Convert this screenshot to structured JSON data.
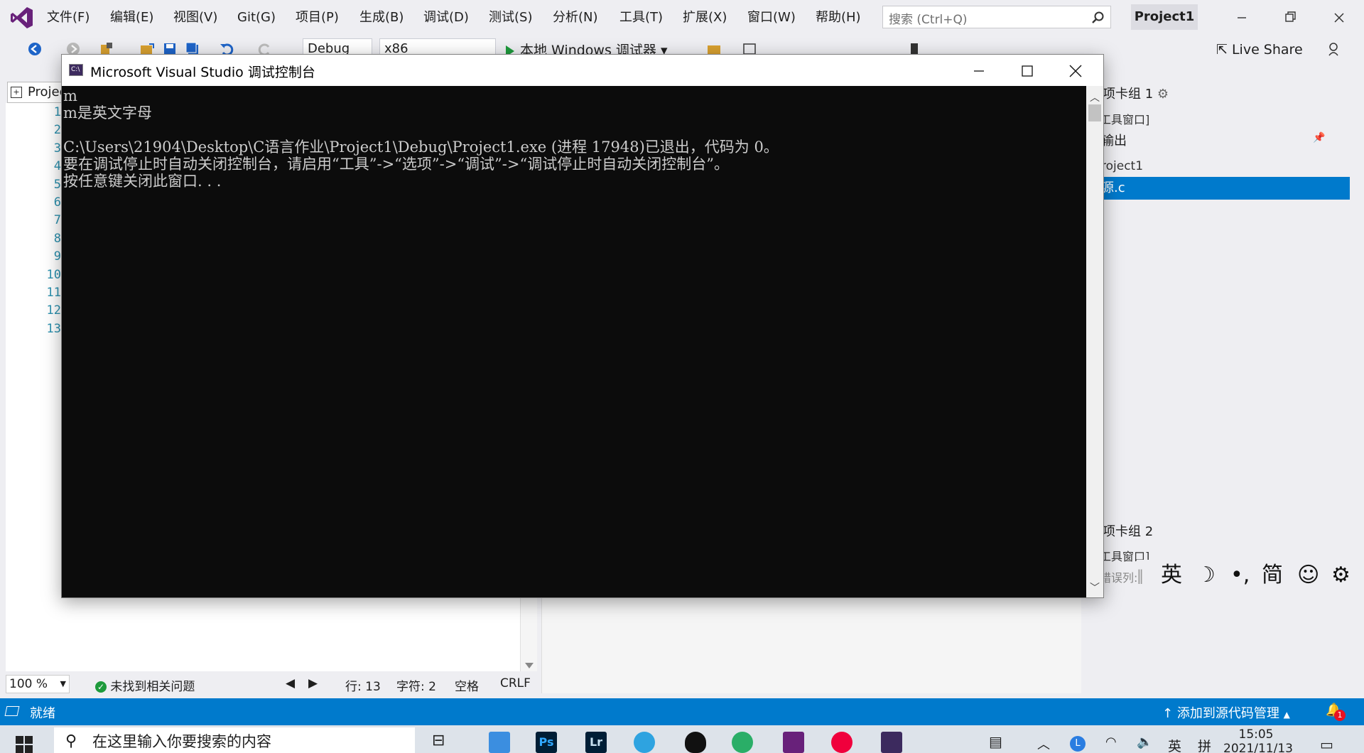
{
  "menubar": {
    "items": [
      "文件(F)",
      "编辑(E)",
      "视图(V)",
      "Git(G)",
      "项目(P)",
      "生成(B)",
      "调试(D)",
      "测试(S)",
      "分析(N)",
      "工具(T)",
      "扩展(X)",
      "窗口(W)",
      "帮助(H)"
    ],
    "search_placeholder": "搜索 (Ctrl+Q)",
    "project_title": "Project1"
  },
  "toolbar": {
    "config": "Debug",
    "platform": "x86",
    "run_label": "本地 Windows 调试器",
    "live_share": "Live Share"
  },
  "editor": {
    "tab_label": "Project1",
    "line_numbers": [
      "1",
      "2",
      "3",
      "4",
      "5",
      "6",
      "7",
      "8",
      "9",
      "10",
      "11",
      "12",
      "13"
    ],
    "zoom": "100 %",
    "issues": "未找到相关问题",
    "line": "行: 13",
    "char": "字符: 2",
    "spaces": "空格",
    "eol": "CRLF"
  },
  "right_panel": {
    "group1": "项卡组 1",
    "tool_window1": "工具窗口]",
    "output": "输出",
    "project": "roject1",
    "selected_file": "源.c",
    "group2": "项卡组 2",
    "tool_window2": "工具窗口]",
    "error_list": "错误列:"
  },
  "ime": {
    "lang": "英",
    "simplified": "简"
  },
  "statusbar": {
    "ready": "就绪",
    "source_control": "添加到源代码管理",
    "notification_count": "1"
  },
  "taskbar": {
    "search_placeholder": "在这里输入你要搜索的内容",
    "apps": [
      "Ps",
      "Lr"
    ],
    "tray_lang": "英",
    "tray_ime": "拼",
    "time": "15:05",
    "date": "2021/11/13"
  },
  "console": {
    "title": "Microsoft Visual Studio 调试控制台",
    "lines": [
      "m",
      "m是英文字母",
      "",
      "C:\\Users\\21904\\Desktop\\C语言作业\\Project1\\Debug\\Project1.exe (进程 17948)已退出，代码为 0。",
      "要在调试停止时自动关闭控制台，请启用“工具”->“选项”->“调试”->“调试停止时自动关闭控制台”。",
      "按任意键关闭此窗口. . ."
    ]
  },
  "colors": {
    "accent": "#007acc",
    "vs_purple": "#68217a",
    "console_bg": "#0c0c0c",
    "console_text": "#cccccc"
  }
}
